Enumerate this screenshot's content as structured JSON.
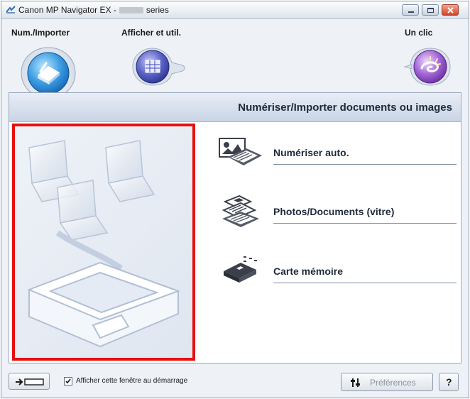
{
  "window": {
    "title_prefix": "Canon MP Navigator EX -",
    "title_suffix": "series",
    "controls": [
      "minimize-icon",
      "maximize-icon",
      "close-icon"
    ]
  },
  "nav": {
    "tabs": [
      {
        "label": "Num./Importer",
        "icon": "scan-import-icon",
        "active": true
      },
      {
        "label": "Afficher et util.",
        "icon": "view-use-icon",
        "active": false
      },
      {
        "label": "Un clic",
        "icon": "one-click-icon",
        "active": false
      }
    ]
  },
  "panel": {
    "title": "Numériser/Importer documents ou images",
    "items": [
      {
        "label": "Numériser auto.",
        "icon": "auto-scan-icon"
      },
      {
        "label": "Photos/Documents (vitre)",
        "icon": "photos-documents-platen-icon"
      },
      {
        "label": "Carte mémoire",
        "icon": "memory-card-icon"
      }
    ]
  },
  "footer": {
    "show_window_label": "Afficher cette fenêtre au démarrage",
    "show_window_checked": true,
    "preferences_label": "Préférences",
    "help_label": "?"
  },
  "colors": {
    "highlight_border": "#e61010",
    "header_bg": "#c9d4e5",
    "accent_blue": "#2f8fd8",
    "accent_purple": "#8c5cc8"
  }
}
